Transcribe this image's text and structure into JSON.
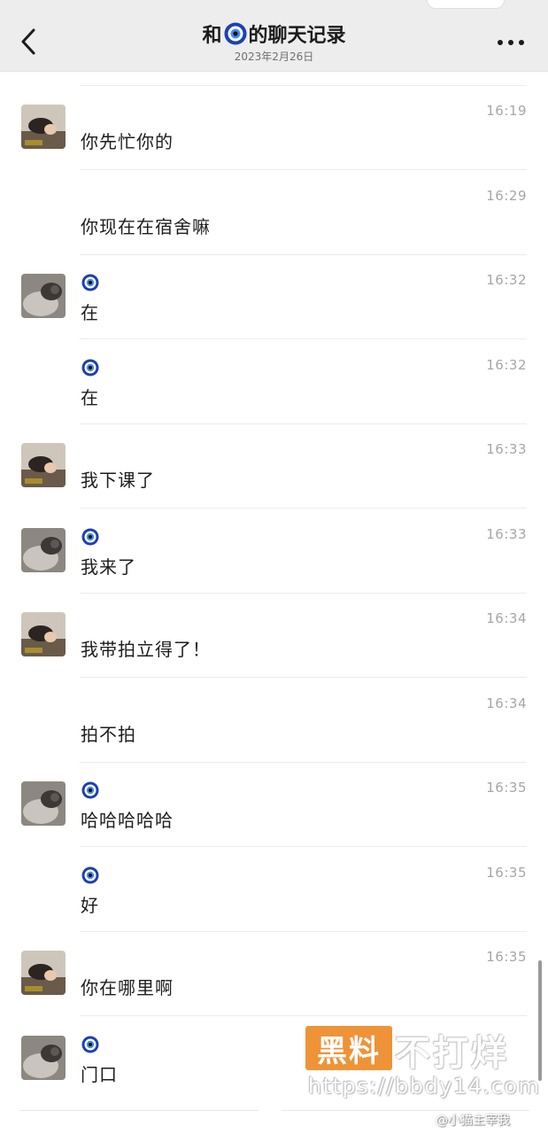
{
  "header": {
    "title_prefix": "和",
    "title_suffix": "的聊天记录",
    "date": "2023年2月26日",
    "back_icon": "chevron-left-icon",
    "more_icon": "more-dots-icon"
  },
  "messages": [
    {
      "avatar": "avatar-a",
      "show_avatar": true,
      "sender_icon": false,
      "time": "16:19",
      "text": "你先忙你的"
    },
    {
      "avatar": "avatar-a",
      "show_avatar": false,
      "sender_icon": false,
      "time": "16:29",
      "text": "你现在在宿舍嘛"
    },
    {
      "avatar": "avatar-b",
      "show_avatar": true,
      "sender_icon": true,
      "time": "16:32",
      "text": "在"
    },
    {
      "avatar": "avatar-b",
      "show_avatar": false,
      "sender_icon": true,
      "time": "16:32",
      "text": "在"
    },
    {
      "avatar": "avatar-a",
      "show_avatar": true,
      "sender_icon": false,
      "time": "16:33",
      "text": "我下课了"
    },
    {
      "avatar": "avatar-b",
      "show_avatar": true,
      "sender_icon": true,
      "time": "16:33",
      "text": "我来了"
    },
    {
      "avatar": "avatar-a",
      "show_avatar": true,
      "sender_icon": false,
      "time": "16:34",
      "text": "我带拍立得了！"
    },
    {
      "avatar": "avatar-a",
      "show_avatar": false,
      "sender_icon": false,
      "time": "16:34",
      "text": "拍不拍"
    },
    {
      "avatar": "avatar-b",
      "show_avatar": true,
      "sender_icon": true,
      "time": "16:35",
      "text": "哈哈哈哈哈"
    },
    {
      "avatar": "avatar-b",
      "show_avatar": false,
      "sender_icon": true,
      "time": "16:35",
      "text": "好"
    },
    {
      "avatar": "avatar-a",
      "show_avatar": true,
      "sender_icon": false,
      "time": "16:35",
      "text": "你在哪里啊"
    },
    {
      "avatar": "avatar-b",
      "show_avatar": true,
      "sender_icon": true,
      "time": "",
      "text": "门口"
    }
  ],
  "watermark": {
    "block_text": "黑料",
    "text": "不打烊",
    "url": "https://bbdy14.com",
    "weibo": "@小猫主宰我"
  },
  "colors": {
    "header_bg": "#ededed",
    "eye_blue": "#1e3fb0",
    "watermark_orange": "#ee8a28"
  }
}
